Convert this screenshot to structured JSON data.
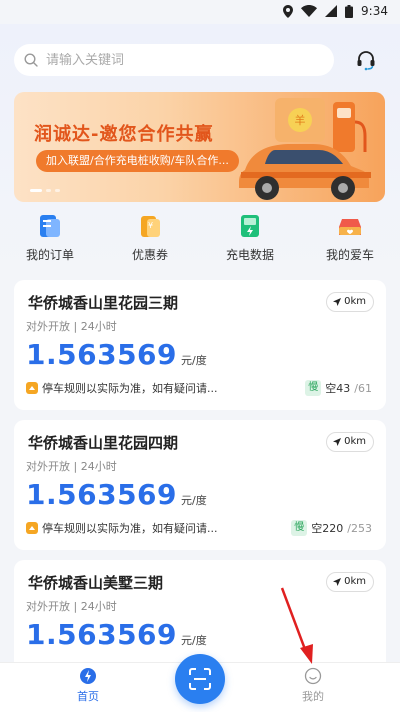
{
  "status_bar": {
    "time": "9:34"
  },
  "search": {
    "placeholder": "请输入关键词"
  },
  "banner": {
    "title": "润诚达-邀您合作共赢",
    "pill": "加入联盟/合作充电桩收购/车队合作...",
    "coin_text": "羊"
  },
  "quick_menu": [
    {
      "label": "我的订单",
      "icon": "order-icon"
    },
    {
      "label": "优惠券",
      "icon": "coupon-icon"
    },
    {
      "label": "充电数据",
      "icon": "charging-data-icon"
    },
    {
      "label": "我的爱车",
      "icon": "car-icon"
    }
  ],
  "stations": [
    {
      "name": "华侨城香山里花园三期",
      "distance": "0km",
      "meta": "对外开放 | 24小时",
      "price": "1.563569",
      "unit": "元/度",
      "rule": "停车规则以实际为准，如有疑问请...",
      "slow_tag": "慢",
      "free": "空43",
      "total": "/61"
    },
    {
      "name": "华侨城香山里花园四期",
      "distance": "0km",
      "meta": "对外开放 | 24小时",
      "price": "1.563569",
      "unit": "元/度",
      "rule": "停车规则以实际为准，如有疑问请...",
      "slow_tag": "慢",
      "free": "空220",
      "total": "/253"
    },
    {
      "name": "华侨城香山美墅三期",
      "distance": "0km",
      "meta": "对外开放 | 24小时",
      "price": "1.563569",
      "unit": "元/度",
      "rule": "",
      "slow_tag": "",
      "free": "",
      "total": ""
    }
  ],
  "tabbar": {
    "home": "首页",
    "mine": "我的"
  },
  "colors": {
    "accent": "#2a6ee8",
    "banner_orange": "#f07a2c",
    "slow_green": "#2aa65c",
    "annotation_red": "#e02020"
  }
}
